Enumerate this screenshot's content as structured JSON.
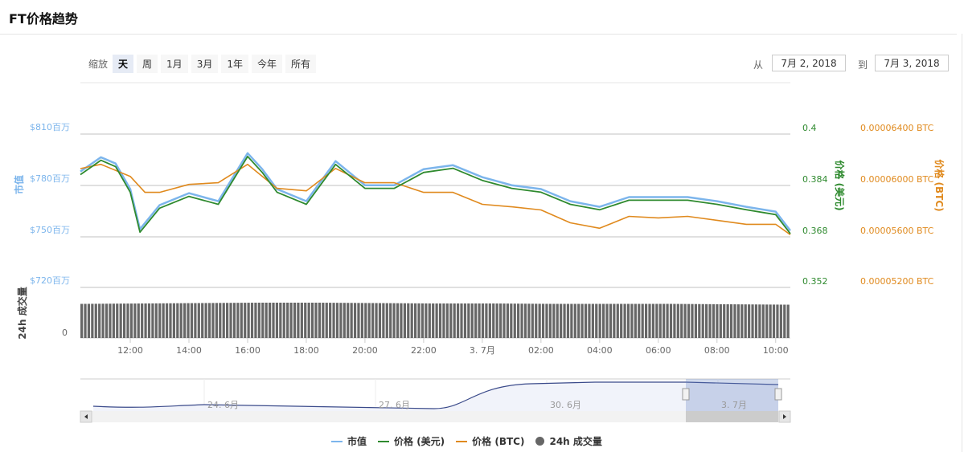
{
  "title": "FT价格趋势",
  "zoom": {
    "label": "缩放",
    "buttons": [
      "天",
      "周",
      "1月",
      "3月",
      "1年",
      "今年",
      "所有"
    ],
    "selected": 0
  },
  "range": {
    "from_label": "从",
    "from": "7月 2, 2018",
    "to_label": "到",
    "to": "7月 3, 2018"
  },
  "colors": {
    "market_cap": "#7cb5ec",
    "price_usd": "#2f8a2f",
    "price_btc": "#e08a1e",
    "volume": "#666666"
  },
  "chart_data": {
    "type": "line",
    "x_unit": "hours since 7/2 00:00",
    "x_ticks": [
      {
        "t": 12,
        "label": "12:00"
      },
      {
        "t": 14,
        "label": "14:00"
      },
      {
        "t": 16,
        "label": "16:00"
      },
      {
        "t": 18,
        "label": "18:00"
      },
      {
        "t": 20,
        "label": "20:00"
      },
      {
        "t": 22,
        "label": "22:00"
      },
      {
        "t": 24,
        "label": "3. 7月"
      },
      {
        "t": 26,
        "label": "02:00"
      },
      {
        "t": 28,
        "label": "04:00"
      },
      {
        "t": 30,
        "label": "06:00"
      },
      {
        "t": 32,
        "label": "08:00"
      },
      {
        "t": 34,
        "label": "10:00"
      }
    ],
    "xlim": [
      10.3,
      34.5
    ],
    "axes": {
      "market_cap": {
        "title": "市值",
        "ticks": [
          "$720百万",
          "$750百万",
          "$780百万",
          "$810百万"
        ],
        "ylim": [
          720,
          810
        ]
      },
      "price_usd": {
        "title": "价格 (美元)",
        "ticks": [
          "0.352",
          "0.368",
          "0.384",
          "0.4"
        ],
        "ylim": [
          0.352,
          0.4
        ]
      },
      "price_btc": {
        "title": "价格 (BTC)",
        "ticks": [
          "0.00005200 BTC",
          "0.00005600 BTC",
          "0.00006000 BTC",
          "0.00006400 BTC"
        ],
        "ylim": [
          5.2e-05,
          6.4e-05
        ]
      },
      "volume": {
        "title": "24h 成交量",
        "ticks": [
          "0"
        ]
      }
    },
    "series": [
      {
        "name": "市值",
        "key": "market_cap",
        "t": [
          10.3,
          11,
          11.5,
          12,
          12.33,
          13,
          14,
          15,
          16,
          16.5,
          17,
          18,
          19,
          20,
          21,
          22,
          23,
          24,
          25,
          26,
          27,
          28,
          29,
          30,
          31,
          32,
          33,
          34,
          34.5
        ],
        "values": [
          788.0,
          796.4,
          792.7,
          777.7,
          754.2,
          768.3,
          775.3,
          770.6,
          798.8,
          789.4,
          777.7,
          770.6,
          794.1,
          780,
          780,
          789.4,
          791.7,
          784.7,
          780,
          777.7,
          770.6,
          767.3,
          773,
          773,
          773,
          770.6,
          767.3,
          764.5,
          753.3
        ]
      },
      {
        "name": "价格 (美元)",
        "key": "price_usd",
        "t": [
          10.3,
          11,
          11.5,
          12,
          12.33,
          13,
          14,
          15,
          16,
          16.5,
          17,
          18,
          19,
          20,
          21,
          22,
          23,
          24,
          25,
          26,
          27,
          28,
          29,
          30,
          31,
          32,
          33,
          34,
          34.5
        ],
        "values": [
          0.3873,
          0.3918,
          0.3898,
          0.3818,
          0.3693,
          0.3768,
          0.3805,
          0.378,
          0.393,
          0.388,
          0.3818,
          0.378,
          0.3905,
          0.383,
          0.383,
          0.388,
          0.3893,
          0.3855,
          0.383,
          0.3818,
          0.378,
          0.3763,
          0.3793,
          0.3793,
          0.3793,
          0.378,
          0.3763,
          0.3748,
          0.3688
        ]
      },
      {
        "name": "价格 (BTC)",
        "key": "price_btc",
        "t": [
          10.3,
          11,
          12,
          12.5,
          13,
          14,
          15,
          16,
          17,
          18,
          19,
          20,
          21,
          22,
          23,
          24,
          25,
          26,
          27,
          28,
          29,
          30,
          31,
          32,
          33,
          34,
          34.5
        ],
        "values": [
          6.13e-05,
          6.163e-05,
          6.069e-05,
          5.944e-05,
          5.944e-05,
          6.006e-05,
          6.019e-05,
          6.163e-05,
          5.975e-05,
          5.956e-05,
          6.131e-05,
          6.019e-05,
          6.019e-05,
          5.944e-05,
          5.944e-05,
          5.85e-05,
          5.831e-05,
          5.806e-05,
          5.706e-05,
          5.663e-05,
          5.756e-05,
          5.744e-05,
          5.756e-05,
          5.725e-05,
          5.694e-05,
          5.694e-05,
          5.613e-05
        ]
      },
      {
        "name": "24h 成交量",
        "key": "volume",
        "relative_levels": [
          0.85,
          0.86,
          0.87,
          0.88,
          0.88,
          0.87,
          0.86,
          0.86,
          0.85,
          0.85,
          0.85,
          0.84,
          0.83
        ]
      }
    ],
    "legend": [
      "市值",
      "价格 (美元)",
      "价格 (BTC)",
      "24h 成交量"
    ],
    "legend_position": "bottom-center"
  },
  "navigator": {
    "labels": [
      "24. 6月",
      "27. 6月",
      "30. 6月",
      "3. 7月"
    ]
  }
}
